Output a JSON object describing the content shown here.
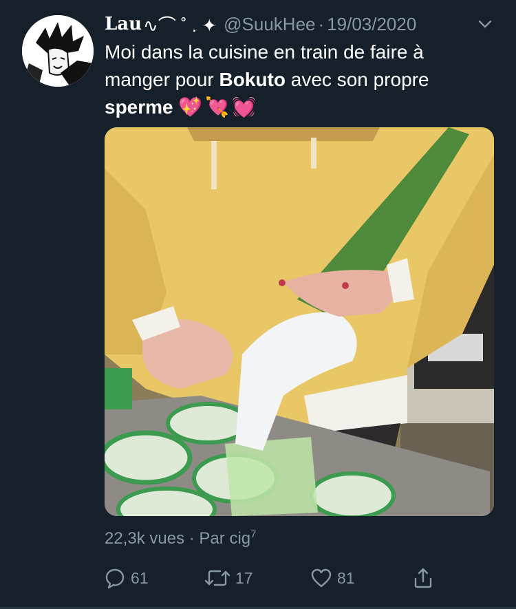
{
  "tweet": {
    "display_name": "Lau",
    "name_decoration": "∿⌒ ˚ . ✦",
    "handle": "@SuukHee",
    "separator": "·",
    "date": "19/03/2020",
    "text_part1": "Moi dans la cuisine en train de faire à manger pour ",
    "text_bold1": "Bokuto",
    "text_part2": " avec son propre ",
    "text_bold2": "sperme",
    "emojis": "💖💘💓",
    "views": "22,3k vues",
    "source_prefix": "· Par ",
    "source": "cig",
    "source_sup": "7"
  },
  "actions": {
    "reply_count": "61",
    "retweet_count": "17",
    "like_count": "81"
  },
  "colors": {
    "background": "#15202b",
    "muted": "#8899a6",
    "text": "#ffffff"
  },
  "icons": {
    "menu": "chevron-down-icon",
    "reply": "reply-icon",
    "retweet": "retweet-icon",
    "like": "heart-icon",
    "share": "share-icon"
  }
}
